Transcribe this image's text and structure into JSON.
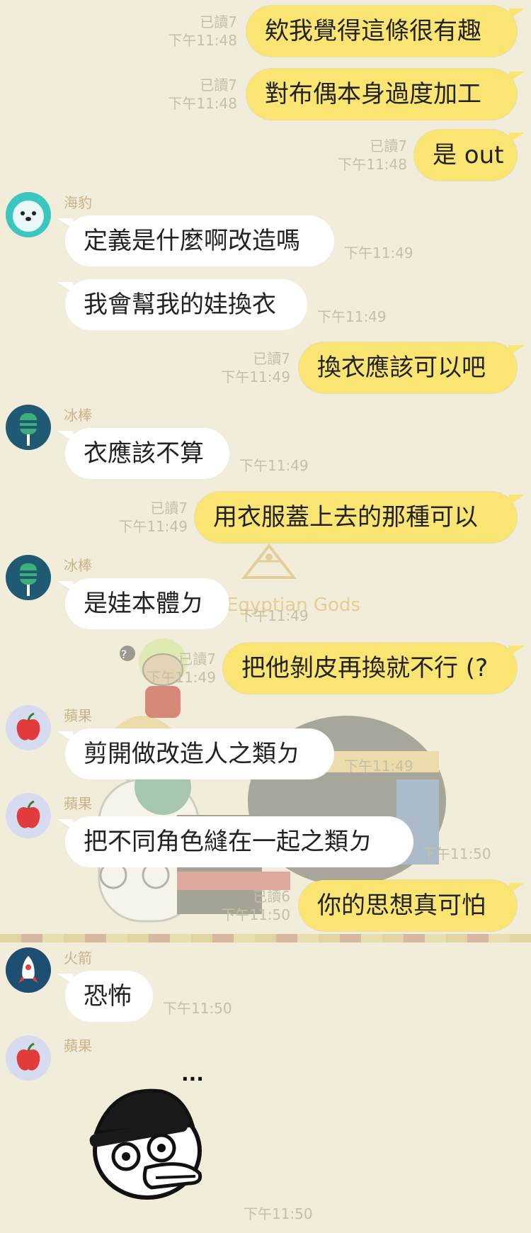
{
  "messages": [
    {
      "type": "out",
      "text": "欸我覺得這條很有趣",
      "read": "已讀7",
      "time": "下午11:48"
    },
    {
      "type": "out",
      "text": "對布偶本身過度加工",
      "read": "已讀7",
      "time": "下午11:48"
    },
    {
      "type": "out",
      "text": "是 out",
      "read": "已讀7",
      "time": "下午11:48"
    },
    {
      "type": "in",
      "sender": "海豹",
      "text": "定義是什麼啊改造嗎",
      "time": "下午11:49",
      "avatar": "seal-avatar-icon"
    },
    {
      "type": "in",
      "text": "我會幫我的娃換衣",
      "time": "下午11:49"
    },
    {
      "type": "out",
      "text": "換衣應該可以吧",
      "read": "已讀7",
      "time": "下午11:49"
    },
    {
      "type": "in",
      "sender": "冰棒",
      "text": "衣應該不算",
      "time": "下午11:49",
      "avatar": "popsicle-avatar-icon"
    },
    {
      "type": "out",
      "text": "用衣服蓋上去的那種可以",
      "read": "已讀7",
      "time": "下午11:49"
    },
    {
      "type": "in",
      "sender": "冰棒",
      "text": "是娃本體ㄉ",
      "time": "下午11:49",
      "avatar": "popsicle-avatar-icon"
    },
    {
      "type": "out",
      "text": "把他剝皮再換就不行 (?",
      "read": "已讀7",
      "time": "下午11:49"
    },
    {
      "type": "in",
      "sender": "蘋果",
      "text": "剪開做改造人之類ㄉ",
      "time": "下午11:49",
      "avatar": "apple-avatar-icon"
    },
    {
      "type": "in",
      "sender": "蘋果",
      "text": "把不同角色縫在一起之類ㄉ",
      "time": "下午11:50",
      "avatar": "apple-avatar-icon"
    },
    {
      "type": "out",
      "text": "你的思想真可怕",
      "read": "已讀6",
      "time": "下午11:50"
    },
    {
      "type": "in",
      "sender": "火箭",
      "text": "恐怖",
      "time": "下午11:50",
      "avatar": "rocket-avatar-icon"
    },
    {
      "type": "in",
      "sender": "蘋果",
      "sticker": "duck-beanie-sticker",
      "sticker_text": "···",
      "time": "下午11:50",
      "avatar": "apple-avatar-icon"
    }
  ],
  "background": {
    "watermark_text": "Egyptian Gods",
    "emoji_badge": "?"
  }
}
